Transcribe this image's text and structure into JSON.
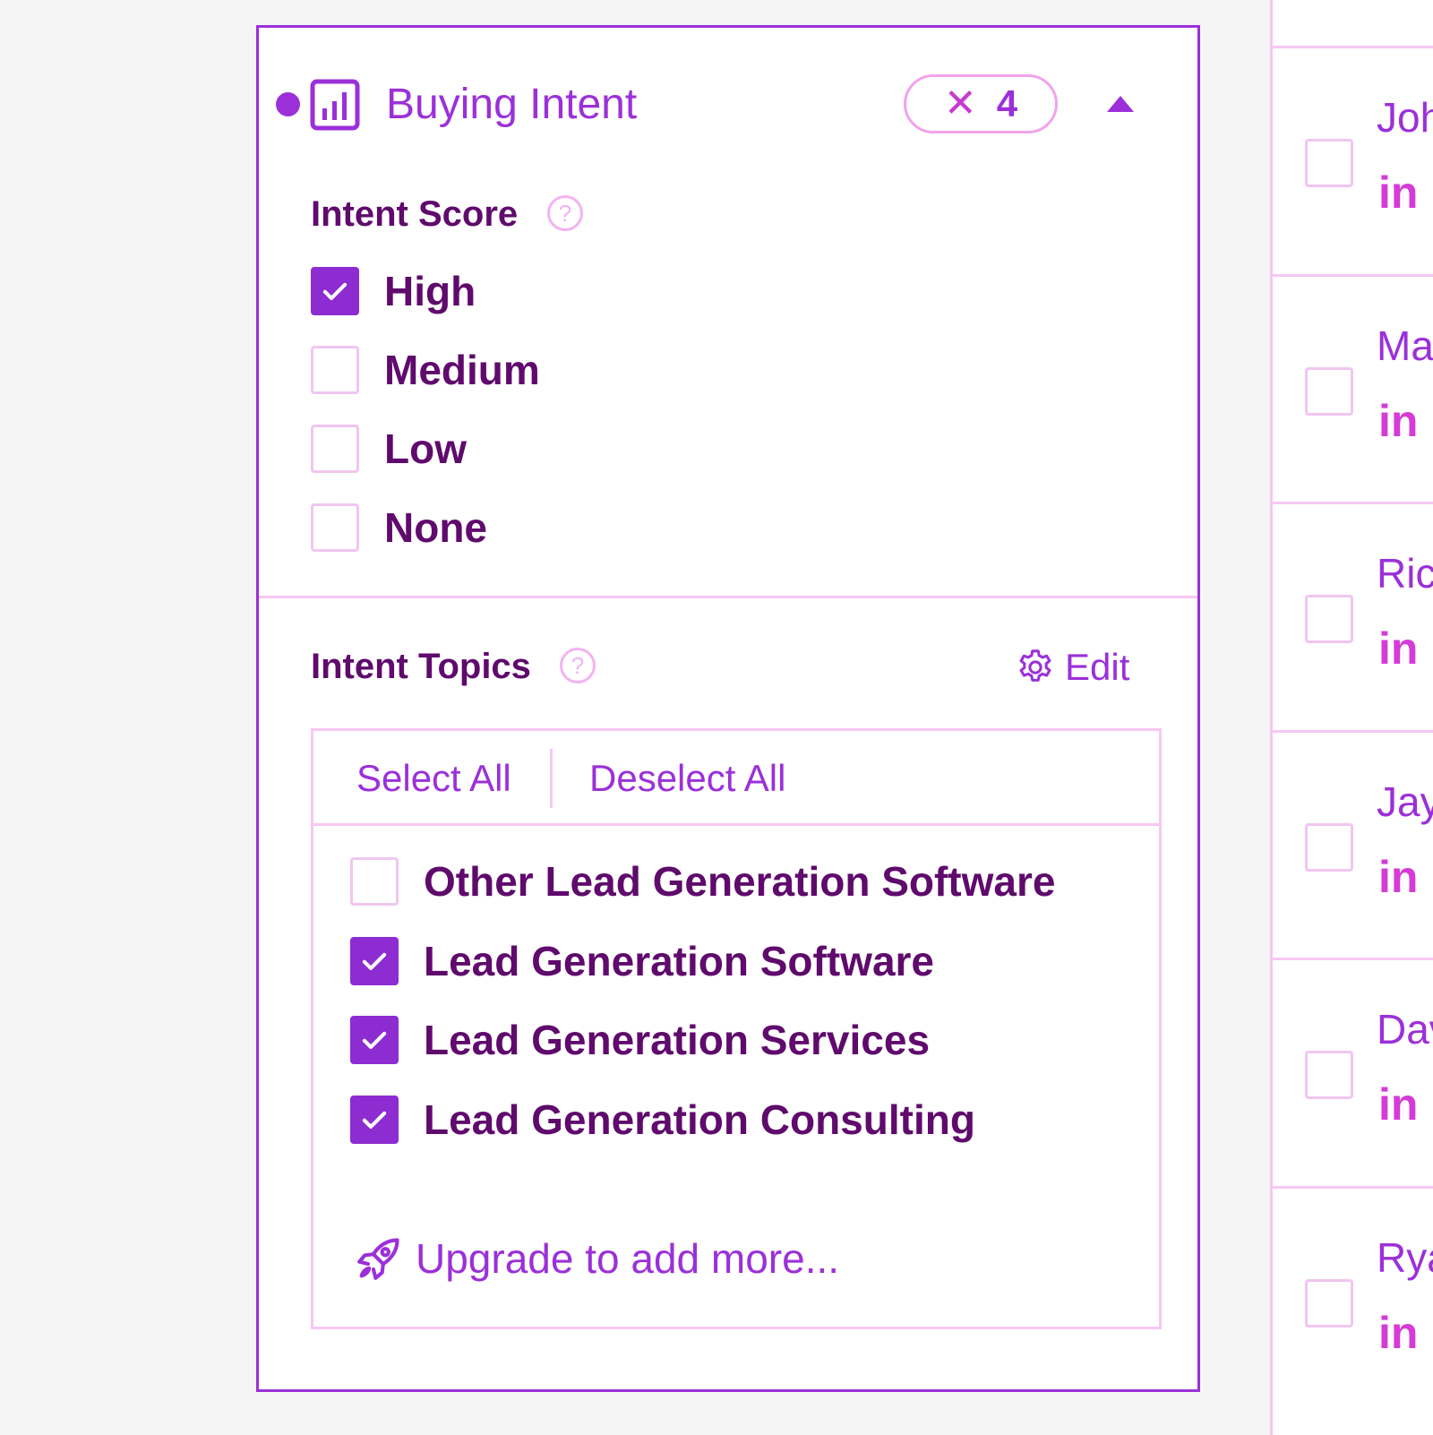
{
  "colors": {
    "accent": "#9b30d9",
    "checked": "#8d2cd0",
    "text": "#5f0a6c",
    "border": "#f6c8f3",
    "linkedin": "#d63bd6"
  },
  "filter": {
    "title": "Buying Intent",
    "title_icon": "bar-chart-icon",
    "active_count": "4",
    "clear_icon": "close-icon",
    "collapse_icon": "caret-up-icon",
    "intent_score": {
      "label": "Intent Score",
      "help": "?",
      "options": [
        {
          "label": "High",
          "checked": true
        },
        {
          "label": "Medium",
          "checked": false
        },
        {
          "label": "Low",
          "checked": false
        },
        {
          "label": "None",
          "checked": false
        }
      ]
    },
    "intent_topics": {
      "label": "Intent Topics",
      "help": "?",
      "edit_label": "Edit",
      "edit_icon": "gear-icon",
      "select_all": "Select All",
      "deselect_all": "Deselect All",
      "options": [
        {
          "label": "Other Lead Generation Software",
          "checked": false
        },
        {
          "label": "Lead Generation Software",
          "checked": true
        },
        {
          "label": "Lead Generation Services",
          "checked": true
        },
        {
          "label": "Lead Generation Consulting",
          "checked": true
        }
      ],
      "upgrade_label": "Upgrade to add more...",
      "upgrade_icon": "rocket-icon"
    }
  },
  "results": {
    "linkedin_label": "in",
    "rows": [
      {
        "name": "Joh"
      },
      {
        "name": "Ma"
      },
      {
        "name": "Ric"
      },
      {
        "name": "Jay"
      },
      {
        "name": "Dav"
      },
      {
        "name": "Rya"
      }
    ]
  }
}
